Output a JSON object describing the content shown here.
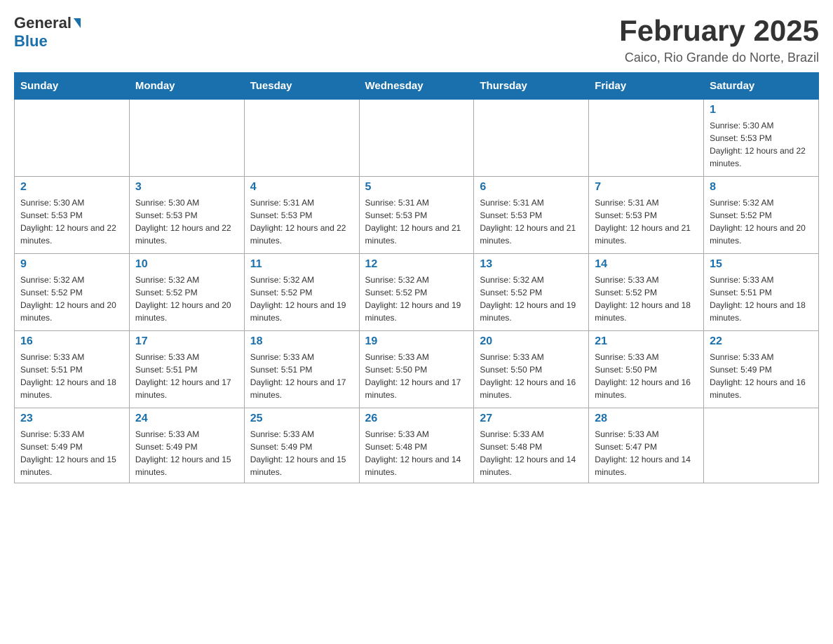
{
  "logo": {
    "general": "General",
    "blue": "Blue"
  },
  "title": "February 2025",
  "location": "Caico, Rio Grande do Norte, Brazil",
  "weekdays": [
    "Sunday",
    "Monday",
    "Tuesday",
    "Wednesday",
    "Thursday",
    "Friday",
    "Saturday"
  ],
  "weeks": [
    [
      {
        "day": "",
        "details": ""
      },
      {
        "day": "",
        "details": ""
      },
      {
        "day": "",
        "details": ""
      },
      {
        "day": "",
        "details": ""
      },
      {
        "day": "",
        "details": ""
      },
      {
        "day": "",
        "details": ""
      },
      {
        "day": "1",
        "details": "Sunrise: 5:30 AM\nSunset: 5:53 PM\nDaylight: 12 hours and 22 minutes."
      }
    ],
    [
      {
        "day": "2",
        "details": "Sunrise: 5:30 AM\nSunset: 5:53 PM\nDaylight: 12 hours and 22 minutes."
      },
      {
        "day": "3",
        "details": "Sunrise: 5:30 AM\nSunset: 5:53 PM\nDaylight: 12 hours and 22 minutes."
      },
      {
        "day": "4",
        "details": "Sunrise: 5:31 AM\nSunset: 5:53 PM\nDaylight: 12 hours and 22 minutes."
      },
      {
        "day": "5",
        "details": "Sunrise: 5:31 AM\nSunset: 5:53 PM\nDaylight: 12 hours and 21 minutes."
      },
      {
        "day": "6",
        "details": "Sunrise: 5:31 AM\nSunset: 5:53 PM\nDaylight: 12 hours and 21 minutes."
      },
      {
        "day": "7",
        "details": "Sunrise: 5:31 AM\nSunset: 5:53 PM\nDaylight: 12 hours and 21 minutes."
      },
      {
        "day": "8",
        "details": "Sunrise: 5:32 AM\nSunset: 5:52 PM\nDaylight: 12 hours and 20 minutes."
      }
    ],
    [
      {
        "day": "9",
        "details": "Sunrise: 5:32 AM\nSunset: 5:52 PM\nDaylight: 12 hours and 20 minutes."
      },
      {
        "day": "10",
        "details": "Sunrise: 5:32 AM\nSunset: 5:52 PM\nDaylight: 12 hours and 20 minutes."
      },
      {
        "day": "11",
        "details": "Sunrise: 5:32 AM\nSunset: 5:52 PM\nDaylight: 12 hours and 19 minutes."
      },
      {
        "day": "12",
        "details": "Sunrise: 5:32 AM\nSunset: 5:52 PM\nDaylight: 12 hours and 19 minutes."
      },
      {
        "day": "13",
        "details": "Sunrise: 5:32 AM\nSunset: 5:52 PM\nDaylight: 12 hours and 19 minutes."
      },
      {
        "day": "14",
        "details": "Sunrise: 5:33 AM\nSunset: 5:52 PM\nDaylight: 12 hours and 18 minutes."
      },
      {
        "day": "15",
        "details": "Sunrise: 5:33 AM\nSunset: 5:51 PM\nDaylight: 12 hours and 18 minutes."
      }
    ],
    [
      {
        "day": "16",
        "details": "Sunrise: 5:33 AM\nSunset: 5:51 PM\nDaylight: 12 hours and 18 minutes."
      },
      {
        "day": "17",
        "details": "Sunrise: 5:33 AM\nSunset: 5:51 PM\nDaylight: 12 hours and 17 minutes."
      },
      {
        "day": "18",
        "details": "Sunrise: 5:33 AM\nSunset: 5:51 PM\nDaylight: 12 hours and 17 minutes."
      },
      {
        "day": "19",
        "details": "Sunrise: 5:33 AM\nSunset: 5:50 PM\nDaylight: 12 hours and 17 minutes."
      },
      {
        "day": "20",
        "details": "Sunrise: 5:33 AM\nSunset: 5:50 PM\nDaylight: 12 hours and 16 minutes."
      },
      {
        "day": "21",
        "details": "Sunrise: 5:33 AM\nSunset: 5:50 PM\nDaylight: 12 hours and 16 minutes."
      },
      {
        "day": "22",
        "details": "Sunrise: 5:33 AM\nSunset: 5:49 PM\nDaylight: 12 hours and 16 minutes."
      }
    ],
    [
      {
        "day": "23",
        "details": "Sunrise: 5:33 AM\nSunset: 5:49 PM\nDaylight: 12 hours and 15 minutes."
      },
      {
        "day": "24",
        "details": "Sunrise: 5:33 AM\nSunset: 5:49 PM\nDaylight: 12 hours and 15 minutes."
      },
      {
        "day": "25",
        "details": "Sunrise: 5:33 AM\nSunset: 5:49 PM\nDaylight: 12 hours and 15 minutes."
      },
      {
        "day": "26",
        "details": "Sunrise: 5:33 AM\nSunset: 5:48 PM\nDaylight: 12 hours and 14 minutes."
      },
      {
        "day": "27",
        "details": "Sunrise: 5:33 AM\nSunset: 5:48 PM\nDaylight: 12 hours and 14 minutes."
      },
      {
        "day": "28",
        "details": "Sunrise: 5:33 AM\nSunset: 5:47 PM\nDaylight: 12 hours and 14 minutes."
      },
      {
        "day": "",
        "details": ""
      }
    ]
  ]
}
